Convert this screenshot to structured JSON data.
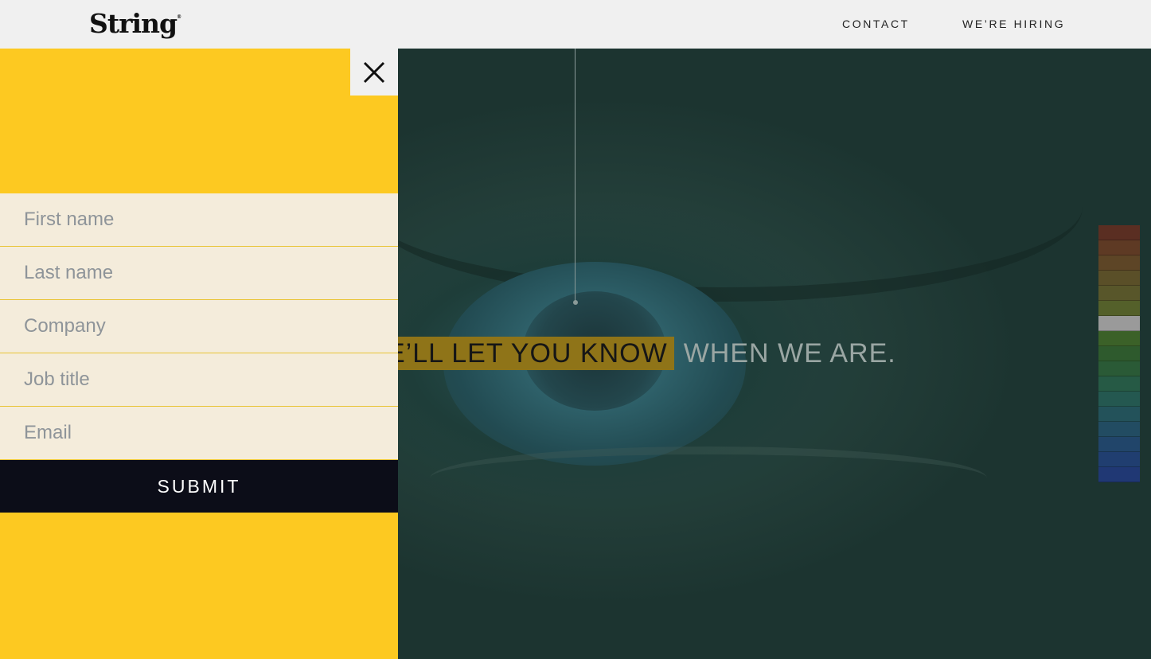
{
  "header": {
    "logo": "String",
    "logo_mark": "®",
    "nav": [
      {
        "label": "CONTACT"
      },
      {
        "label": "WE’RE HIRING"
      }
    ]
  },
  "hero": {
    "headline_highlight": "E’LL LET YOU KNOW",
    "headline_rest": "WHEN WE ARE."
  },
  "panel": {
    "close_icon": "close-icon",
    "fields": [
      {
        "placeholder": "First name"
      },
      {
        "placeholder": "Last name"
      },
      {
        "placeholder": "Company"
      },
      {
        "placeholder": "Job title"
      },
      {
        "placeholder": "Email"
      }
    ],
    "submit_label": "SUBMIT"
  },
  "colors": {
    "panel_bg": "#fdc921",
    "field_bg": "#f4ecdb",
    "submit_bg": "#0c0d18",
    "header_bg": "#f0f0f0",
    "highlight": "#8f7418",
    "swatches": [
      "#5a2e22",
      "#5e3a24",
      "#5d4526",
      "#5a4f28",
      "#58562a",
      "#54602a",
      "#9a9a9a",
      "#3b6128",
      "#2e5a2d",
      "#2a5a36",
      "#265a45",
      "#245850",
      "#23525a",
      "#224c62",
      "#21456a",
      "#203e70",
      "#203874"
    ]
  }
}
